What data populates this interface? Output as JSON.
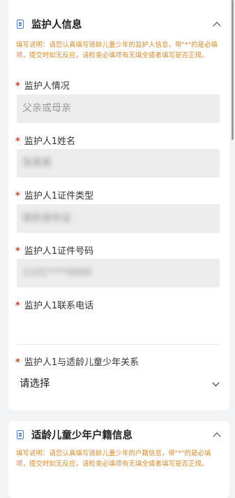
{
  "guardian_section": {
    "title": "监护人信息",
    "note": "填写说明：请您认真填写适龄儿童少年的监护人信息，带\"*\"的是必填项，提交时如无反应，请检查必填项有无填全或者填写是否正规。",
    "fields": [
      {
        "label": "监护人情况",
        "value": "父亲或母亲"
      },
      {
        "label": "监护人1姓名",
        "value": "张某某"
      },
      {
        "label": "监护人1证件类型",
        "value": "居民身份证"
      },
      {
        "label": "监护人1证件号码",
        "value": "1101****0000"
      },
      {
        "label": "监护人1联系电话",
        "value": ""
      },
      {
        "label": "监护人1与适龄儿童少年关系",
        "value": "请选择"
      }
    ]
  },
  "household_section": {
    "title": "适龄儿童少年户籍信息",
    "note": "填写说明：请您认真填写适龄儿童少年的户籍信息，带\"*\"的是必填项，提交时如无反应，请检查必填项有无填全或者填写是否正规。"
  },
  "required_mark": "*",
  "colors": {
    "accent": "#4a7be0",
    "note": "#d98a2b",
    "required": "#e0342a",
    "input_bg": "#ededed",
    "page_bg": "#f2f3f5"
  }
}
